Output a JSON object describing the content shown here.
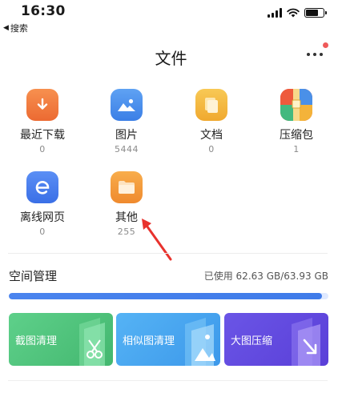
{
  "status_bar": {
    "time": "16:30",
    "battery_level": 0.7
  },
  "nav": {
    "back_label": "搜索"
  },
  "header": {
    "title": "文件"
  },
  "categories": [
    {
      "label": "最近下载",
      "count": "0",
      "icon": "download-icon",
      "color": "#f07a3f"
    },
    {
      "label": "图片",
      "count": "5444",
      "icon": "image-icon",
      "color": "#4a90e8"
    },
    {
      "label": "文档",
      "count": "0",
      "icon": "document-icon",
      "color": "#f2b23e"
    },
    {
      "label": "压缩包",
      "count": "1",
      "icon": "archive-icon",
      "color": "#e74c3c"
    },
    {
      "label": "离线网页",
      "count": "0",
      "icon": "offline-web-icon",
      "color": "#3d7cf0"
    },
    {
      "label": "其他",
      "count": "255",
      "icon": "folder-icon",
      "color": "#f39a3a"
    }
  ],
  "storage": {
    "title": "空间管理",
    "usage_text": "已使用 62.63 GB/63.93 GB",
    "used_fraction": 0.98
  },
  "tools": [
    {
      "label": "截图清理",
      "icon": "scissors-icon",
      "color": "#52c77d"
    },
    {
      "label": "相似图清理",
      "icon": "similar-images-icon",
      "color": "#48a7f0"
    },
    {
      "label": "大图压缩",
      "icon": "compress-icon",
      "color": "#6b4fe0"
    }
  ]
}
